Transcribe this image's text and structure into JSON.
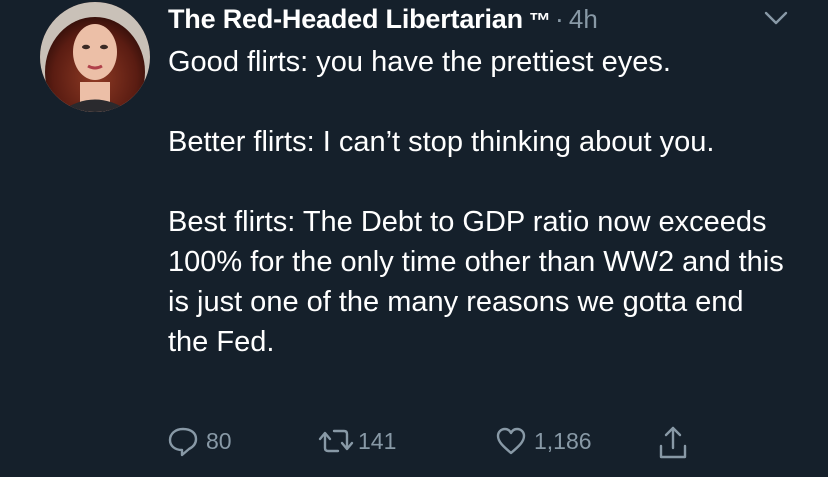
{
  "tweet": {
    "author_name": "The Red-Headed Libertarian",
    "trademark": "™",
    "separator": "·",
    "time": "4h",
    "paragraphs": [
      "Good flirts: you have the prettiest eyes.",
      "Better flirts: I can’t stop thinking about you.",
      "Best flirts: The Debt to GDP ratio now exceeds 100% for the only time other than WW2 and this is just one of the many reasons we gotta end the Fed."
    ]
  },
  "actions": {
    "reply_count": "80",
    "retweet_count": "141",
    "like_count": "1,186"
  },
  "icons": {
    "reply": "reply-icon",
    "retweet": "retweet-icon",
    "like": "heart-icon",
    "share": "share-icon",
    "more": "chevron-down-icon"
  },
  "colors": {
    "background": "#15202b",
    "text": "#ffffff",
    "secondary": "#8899a6"
  }
}
